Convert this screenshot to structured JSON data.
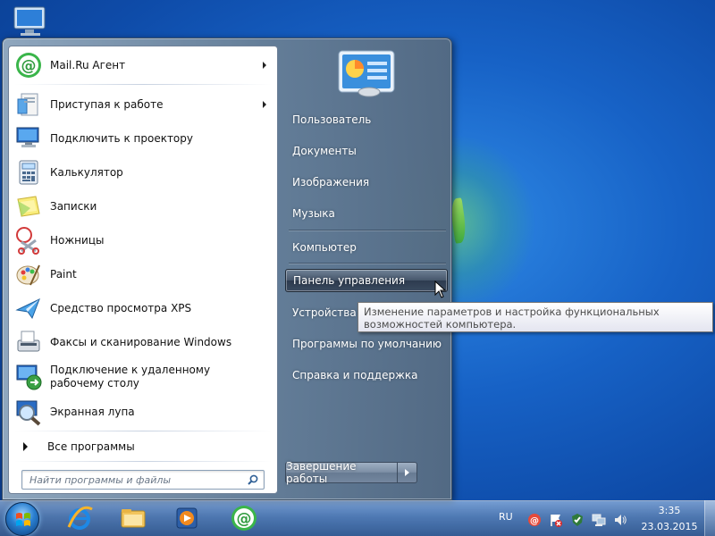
{
  "desktop": {
    "icon": "computer-icon"
  },
  "start_menu": {
    "left_items": [
      {
        "label": "Mail.Ru Агент",
        "icon": "mailru-agent-icon",
        "has_submenu": true
      },
      {
        "label": "Приступая к работе",
        "icon": "getting-started-icon",
        "has_submenu": true
      },
      {
        "label": "Подключить к проектору",
        "icon": "projector-icon",
        "has_submenu": false
      },
      {
        "label": "Калькулятор",
        "icon": "calculator-icon",
        "has_submenu": false
      },
      {
        "label": "Записки",
        "icon": "sticky-notes-icon",
        "has_submenu": false
      },
      {
        "label": "Ножницы",
        "icon": "scissors-icon",
        "has_submenu": false
      },
      {
        "label": "Paint",
        "icon": "paint-icon",
        "has_submenu": false
      },
      {
        "label": "Средство просмотра XPS",
        "icon": "xps-viewer-icon",
        "has_submenu": false
      },
      {
        "label": "Факсы и сканирование Windows",
        "icon": "fax-scan-icon",
        "has_submenu": false
      },
      {
        "label": "Подключение к удаленному рабочему столу",
        "icon": "remote-desktop-icon",
        "has_submenu": false
      },
      {
        "label": "Экранная лупа",
        "icon": "magnifier-icon",
        "has_submenu": false
      }
    ],
    "all_programs": "Все программы",
    "search_placeholder": "Найти программы и файлы",
    "right_items": [
      {
        "label": "Пользователь"
      },
      {
        "label": "Документы"
      },
      {
        "label": "Изображения"
      },
      {
        "label": "Музыка"
      },
      {
        "label": "Компьютер"
      },
      {
        "label": "Панель управления"
      },
      {
        "label": "Устройства и"
      },
      {
        "label": "Программы по умолчанию"
      },
      {
        "label": "Справка и поддержка"
      }
    ],
    "shutdown_label": "Завершение работы"
  },
  "tooltip": {
    "text": "Изменение параметров и настройка функциональных возможностей компьютера."
  },
  "taskbar": {
    "pinned": [
      {
        "icon": "internet-explorer-icon"
      },
      {
        "icon": "file-explorer-icon"
      },
      {
        "icon": "media-player-icon"
      },
      {
        "icon": "mailru-agent-icon"
      }
    ],
    "language": "RU",
    "tray_icons": [
      "mailru-tray-icon",
      "action-center-icon",
      "security-icon",
      "network-icon",
      "volume-icon"
    ],
    "time": "3:35",
    "date": "23.03.2015"
  },
  "colors": {
    "desktop_blue": "#1762c6",
    "menu_hover": "#3a4a5f",
    "tooltip_text": "#4c4c4c"
  }
}
